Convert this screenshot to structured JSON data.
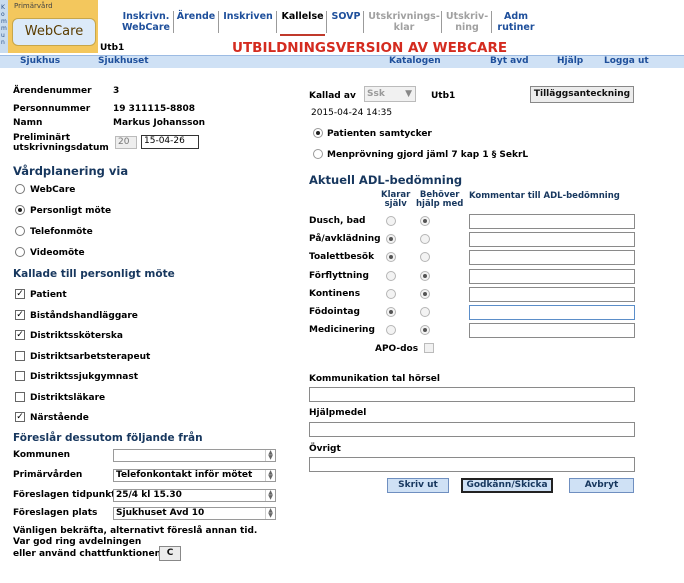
{
  "header": {
    "kommun_letters": [
      "K",
      "o",
      "m",
      "m",
      "u",
      "n"
    ],
    "logo_top": "Primärvård",
    "logo_word": "WebCare",
    "tabs": [
      {
        "label": "Inskrivn.\nWebCare",
        "state": "normal"
      },
      {
        "label": "Ärende",
        "state": "normal"
      },
      {
        "label": "Inskriven",
        "state": "normal"
      },
      {
        "label": "Kallelse",
        "state": "active"
      },
      {
        "label": "SOVP",
        "state": "normal"
      },
      {
        "label": "Utskrivnings-\nklar",
        "state": "disabled"
      },
      {
        "label": "Utskriv-\nning",
        "state": "disabled"
      },
      {
        "label": "Adm\nrutiner",
        "state": "normal"
      }
    ],
    "unit": "Utb1",
    "banner": "UTBILDNINGSVERSION AV WEBCARE"
  },
  "navbar": {
    "left1": "Sjukhus",
    "left2": "Sjukhuset",
    "catalog": "Katalogen",
    "change_dept": "Byt avd",
    "help": "Hjälp",
    "logout": "Logga ut"
  },
  "patient": {
    "case_label": "Ärendenummer",
    "case_value": "3",
    "pnr_label": "Personnummer",
    "pnr_value": "19 311115-8808",
    "name_label": "Namn",
    "name_value": "Markus Johansson",
    "discharge_label": "Preliminärt\nutskrivningsdatum",
    "discharge_prefix": "20",
    "discharge_value": "15-04-26"
  },
  "care_planning": {
    "title": "Vårdplanering via",
    "options": [
      {
        "label": "WebCare",
        "selected": false
      },
      {
        "label": "Personligt möte",
        "selected": true
      },
      {
        "label": "Telefonmöte",
        "selected": false
      },
      {
        "label": "Videomöte",
        "selected": false
      }
    ]
  },
  "invited": {
    "title": "Kallade till personligt möte",
    "items": [
      {
        "label": "Patient",
        "checked": true
      },
      {
        "label": "Biståndshandläggare",
        "checked": true
      },
      {
        "label": "Distriktssköterska",
        "checked": true
      },
      {
        "label": "Distriktsarbetsterapeut",
        "checked": false
      },
      {
        "label": "Distriktssjukgymnast",
        "checked": false
      },
      {
        "label": "Distriktsläkare",
        "checked": false
      },
      {
        "label": "Närstående",
        "checked": true
      }
    ]
  },
  "proposals": {
    "title": "Föreslår dessutom följande från",
    "rows": [
      {
        "label": "Kommunen",
        "value": ""
      },
      {
        "label": "Primärvården",
        "value": "Telefonkontakt inför mötet"
      },
      {
        "label": "Föreslagen tidpunkt",
        "value": "25/4 kl 15.30"
      },
      {
        "label": "Föreslagen plats",
        "value": "Sjukhuset Avd 10"
      }
    ],
    "note1": "Vänligen bekräfta, alternativt föreslå annan tid.",
    "note2": "Var god ring avdelningen",
    "note3": "eller använd chattfunktionen:",
    "chat_button": "C"
  },
  "called": {
    "label": "Kallad av",
    "select_value": "Ssk",
    "unit": "Utb1",
    "add_note_button": "Tilläggsanteckning",
    "timestamp": "2015-04-24 14:35",
    "consent_options": [
      {
        "label": "Patienten samtycker",
        "selected": true
      },
      {
        "label": "Menprövning gjord jäml 7 kap 1 § SekrL",
        "selected": false
      }
    ]
  },
  "adl": {
    "title": "Aktuell ADL-bedömning",
    "col_self": "Klarar\nsjälv",
    "col_help": "Behöver\nhjälp med",
    "col_comment": "Kommentar till ADL-bedömning",
    "rows": [
      {
        "label": "Dusch, bad",
        "choice": "help"
      },
      {
        "label": "På/avklädning",
        "choice": "self"
      },
      {
        "label": "Toalettbesök",
        "choice": "self"
      },
      {
        "label": "Förflyttning",
        "choice": "help"
      },
      {
        "label": "Kontinens",
        "choice": "help"
      },
      {
        "label": "Födointag",
        "choice": "self"
      },
      {
        "label": "Medicinering",
        "choice": "help"
      }
    ],
    "apo_label": "APO-dos"
  },
  "fields": {
    "communication_label": "Kommunikation tal hörsel",
    "aids_label": "Hjälpmedel",
    "other_label": "Övrigt"
  },
  "actions": {
    "print": "Skriv ut",
    "approve": "Godkänn/Skicka",
    "cancel": "Avbryt"
  }
}
